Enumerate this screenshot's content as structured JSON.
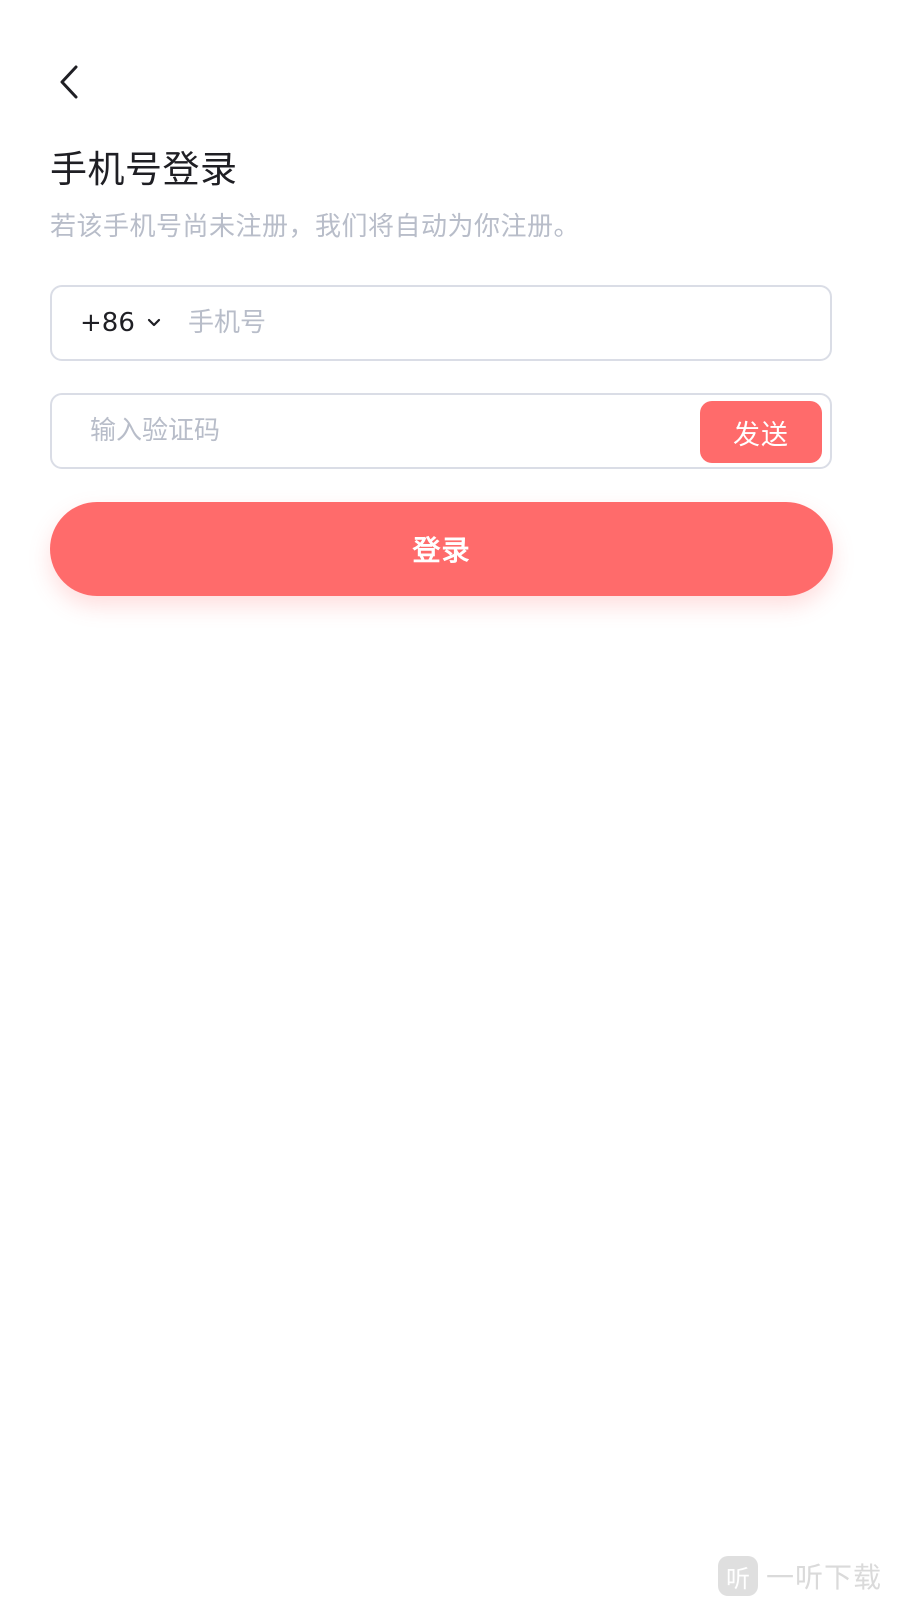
{
  "header": {
    "back_icon": "chevron-left-icon"
  },
  "page": {
    "title": "手机号登录",
    "subtitle": "若该手机号尚未注册，我们将自动为你注册。"
  },
  "phone_field": {
    "country_code": "+86",
    "chevron_icon": "chevron-down-icon",
    "placeholder": "手机号",
    "value": ""
  },
  "code_field": {
    "placeholder": "输入验证码",
    "value": "",
    "send_label": "发送"
  },
  "login_button": {
    "label": "登录"
  },
  "watermark": {
    "logo_glyph": "听",
    "text": "一听下载"
  },
  "colors": {
    "accent": "#ff6b6b",
    "placeholder": "#b8bdc9",
    "border": "#dadde6",
    "text": "#1f1f24"
  }
}
